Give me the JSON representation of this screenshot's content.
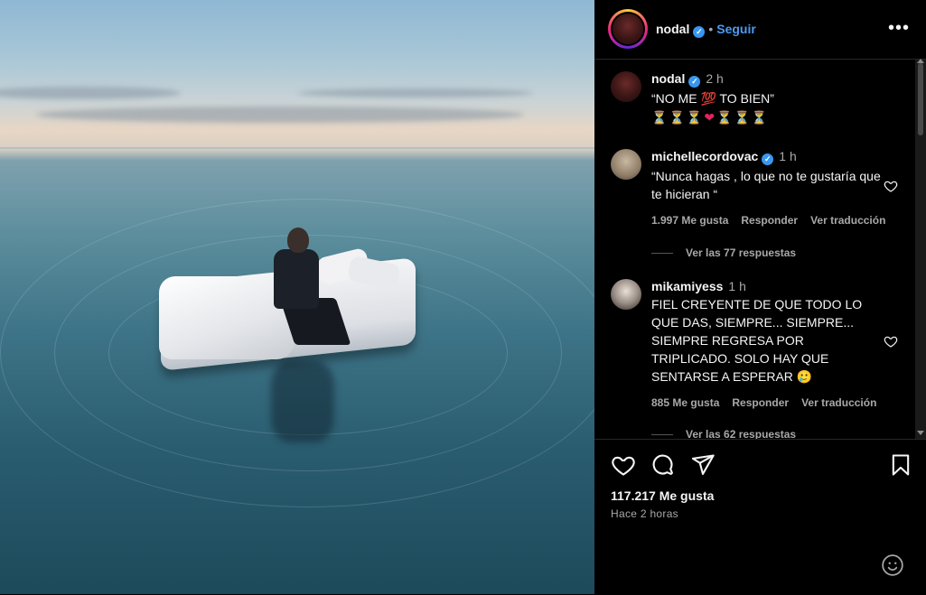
{
  "post": {
    "author": "nodal",
    "follow_label": "Seguir",
    "separator": "•",
    "caption_time": "2 h",
    "caption_line1": "“NO ME 💯 TO BIEN”",
    "caption_emojis": {
      "glass": "⏳",
      "heart": "❤"
    },
    "likes": "117.217 Me gusta",
    "posted_ago": "Hace 2 horas"
  },
  "comments": [
    {
      "user": "michellecordovac",
      "verified": true,
      "time": "1 h",
      "text": "“Nunca hagas , lo que no te gustaría que te hicieran “",
      "likes": "1.997 Me gusta",
      "reply": "Responder",
      "translate": "Ver traducción",
      "replies": "Ver las 77 respuestas"
    },
    {
      "user": "mikamiyess",
      "verified": false,
      "time": "1 h",
      "text": "FIEL CREYENTE DE QUE TODO LO QUE DAS, SIEMPRE... SIEMPRE... SIEMPRE REGRESA POR TRIPLICADO. SOLO HAY QUE SENTARSE A ESPERAR 🥲",
      "likes": "885 Me gusta",
      "reply": "Responder",
      "translate": "Ver traducción",
      "replies": "Ver las 62 respuestas"
    }
  ],
  "icons": {
    "header": [
      "more-options-icon"
    ],
    "actions": [
      "heart-icon",
      "comment-icon",
      "share-icon",
      "bookmark-icon",
      "emoji-icon"
    ]
  },
  "colors": {
    "accent": "#4d9bf0",
    "verified": "#3897f0",
    "background": "#000000",
    "muted": "#a8a8a8"
  }
}
